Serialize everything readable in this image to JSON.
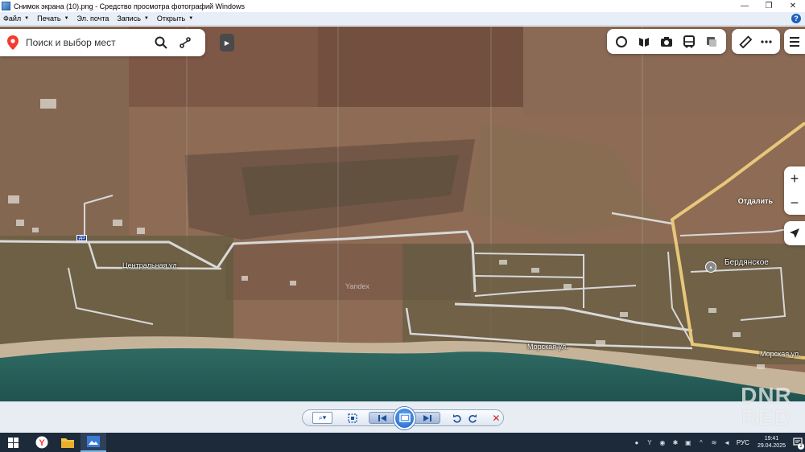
{
  "window": {
    "title": "Снимок экрана (10).png - Средство просмотра фотографий Windows",
    "controls": {
      "minimize": "—",
      "maximize": "❐",
      "close": "✕"
    }
  },
  "menubar": {
    "items": [
      {
        "label": "Файл"
      },
      {
        "label": "Печать"
      },
      {
        "label": "Эл. почта"
      },
      {
        "label": "Запись"
      },
      {
        "label": "Открыть"
      }
    ],
    "help": "?"
  },
  "map": {
    "search_placeholder": "Поиск и выбор мест",
    "zoom_in": "+",
    "zoom_out": "−",
    "zoom_tooltip": "Отдалить",
    "labels": {
      "street_central": "Центральная ул.",
      "street_sea_1": "Морская ул.",
      "street_sea_2": "Морская ул.",
      "town": "Бердянское",
      "watermark": "Yandex",
      "road_number": "Д3"
    },
    "colors": {
      "accent_red": "#f43b2f",
      "road_yellow": "#e8c77a"
    }
  },
  "viewer": {
    "zoom_label": "⌕▾"
  },
  "taskbar": {
    "lang": "РУС",
    "time": "19:41",
    "date": "29.04.2025",
    "notifications": "2"
  },
  "overlay_watermark": {
    "line1": "DNR",
    "line2": "RED"
  }
}
